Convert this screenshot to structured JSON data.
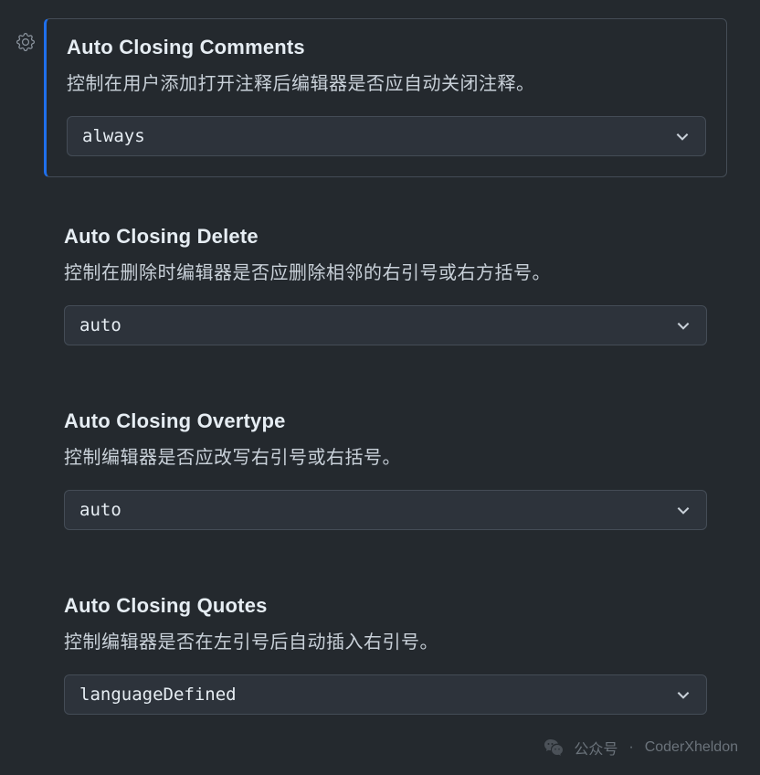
{
  "settings": [
    {
      "title": "Auto Closing Comments",
      "description": "控制在用户添加打开注释后编辑器是否应自动关闭注释。",
      "value": "always",
      "highlighted": true
    },
    {
      "title": "Auto Closing Delete",
      "description": "控制在删除时编辑器是否应删除相邻的右引号或右方括号。",
      "value": "auto",
      "highlighted": false
    },
    {
      "title": "Auto Closing Overtype",
      "description": "控制编辑器是否应改写右引号或右括号。",
      "value": "auto",
      "highlighted": false
    },
    {
      "title": "Auto Closing Quotes",
      "description": "控制编辑器是否在左引号后自动插入右引号。",
      "value": "languageDefined",
      "highlighted": false
    }
  ],
  "watermark": {
    "label": "公众号",
    "separator": "·",
    "author": "CoderXheldon"
  }
}
